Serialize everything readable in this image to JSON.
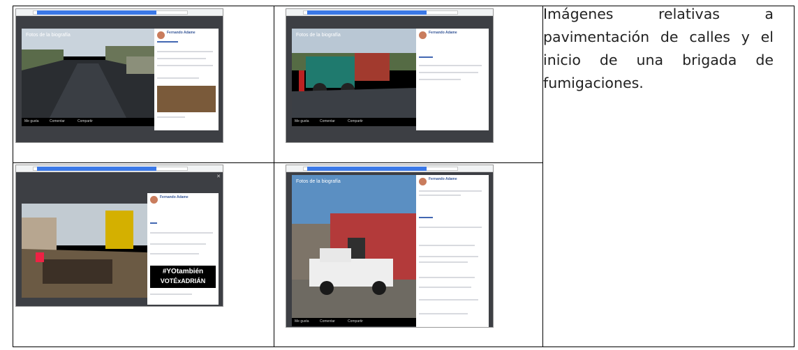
{
  "description_text": "Imágenes relativas a pavimentación de calles y el inicio de una brigada de fumigaciones.",
  "screenshots": [
    {
      "caption": "Fotos de la biografía",
      "author": "Fernando Adame"
    },
    {
      "caption": "Fotos de la biografía",
      "author": "Fernando Adame"
    },
    {
      "caption": "",
      "author": "Fernando Adame",
      "banner_line1": "#YOtambién",
      "banner_line2": "VOTÉxADRIÁN"
    },
    {
      "caption": "Fotos de la biografía",
      "author": "Fernando Adame"
    }
  ],
  "actions": {
    "like": "Me gusta",
    "comment": "Comentar",
    "share": "Compartir"
  }
}
